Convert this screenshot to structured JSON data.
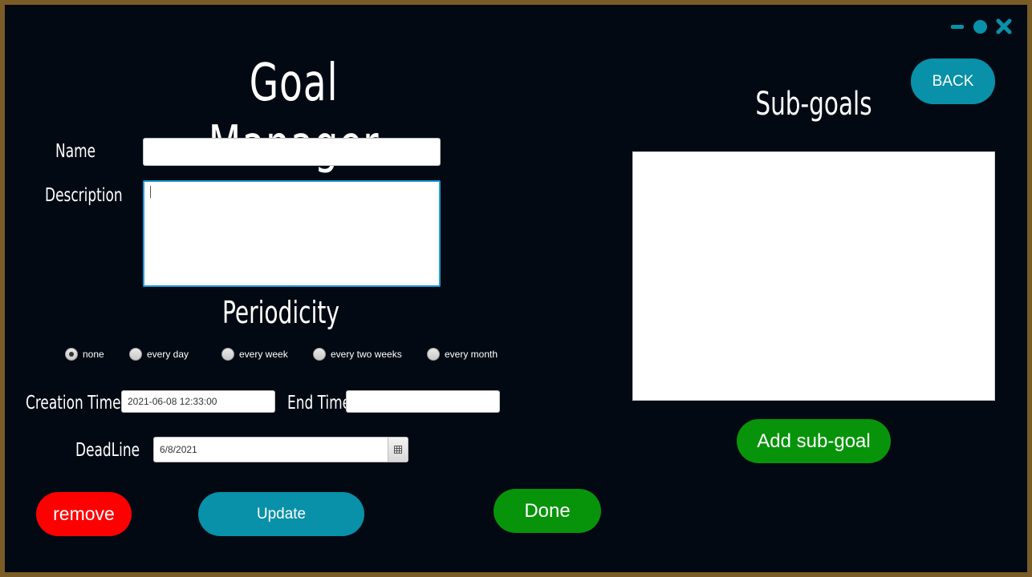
{
  "window": {
    "controls": {
      "minimize_icon": "minimize-icon",
      "maximize_icon": "circle-icon",
      "close_icon": "close-icon"
    },
    "accent": "#0891a8"
  },
  "title": "Goal Manager",
  "form": {
    "name_label": "Name",
    "name_value": "",
    "description_label": "Description",
    "description_value": "",
    "periodicity_title": "Periodicity",
    "periodicity_options": [
      "none",
      "every day",
      "every week",
      "every two weeks",
      "every month"
    ],
    "periodicity_selected": "none",
    "creation_time_label": "Creation Time",
    "creation_time_value": "2021-06-08 12:33:00",
    "end_time_label": "End Time",
    "end_time_value": "",
    "deadline_label": "DeadLine",
    "deadline_value": "6/8/2021",
    "calendar_icon": "calendar-icon"
  },
  "subgoals": {
    "title": "Sub-goals",
    "items": [],
    "add_label": "Add sub-goal"
  },
  "buttons": {
    "back": "BACK",
    "remove": "remove",
    "update": "Update",
    "done": "Done"
  },
  "colors": {
    "background": "#020913",
    "teal": "#0891a8",
    "green": "#07940a",
    "red": "#ff0000",
    "frame": "#7a5c26"
  }
}
